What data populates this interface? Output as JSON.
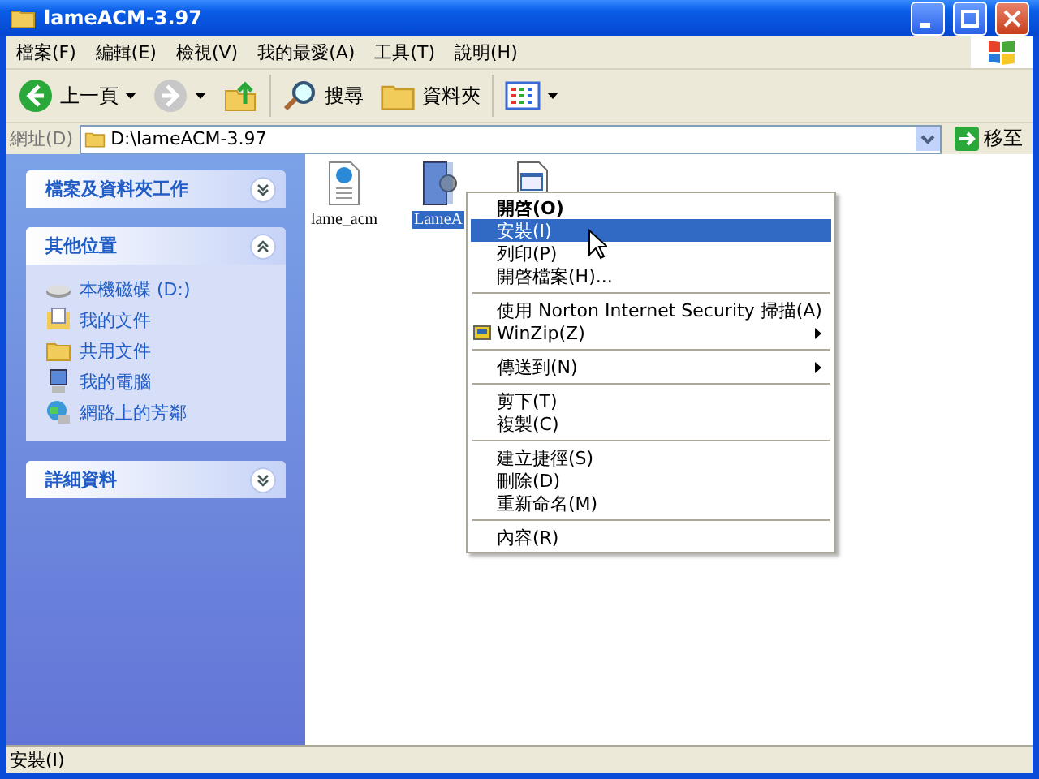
{
  "window": {
    "title": "lameACM-3.97"
  },
  "menu_bar": [
    "檔案(F)",
    "編輯(E)",
    "檢視(V)",
    "我的最愛(A)",
    "工具(T)",
    "說明(H)"
  ],
  "toolbar": [
    {
      "kind": "back",
      "label": "上一頁",
      "disabled": false
    },
    {
      "kind": "forward",
      "disabled": true
    },
    {
      "kind": "up"
    },
    {
      "kind": "search",
      "label": "搜尋",
      "disabled": false
    },
    {
      "kind": "folders",
      "label": "資料夾",
      "disabled": false
    },
    {
      "kind": "views"
    }
  ],
  "address_bar": {
    "label": "網址(D)",
    "value": "D:\\lameACM-3.97",
    "go_label": "移至"
  },
  "sidebar": {
    "panels": [
      {
        "title": "檔案及資料夾工作",
        "expanded": false
      },
      {
        "title": "其他位置",
        "expanded": true,
        "items": [
          {
            "kind": "drive",
            "label": "本機磁碟 (D:)"
          },
          {
            "kind": "documents",
            "label": "我的文件"
          },
          {
            "kind": "folder",
            "label": "共用文件"
          },
          {
            "kind": "computer",
            "label": "我的電腦"
          },
          {
            "kind": "network",
            "label": "網路上的芳鄰"
          }
        ]
      },
      {
        "title": "詳細資料",
        "expanded": false
      }
    ]
  },
  "files": [
    {
      "kind": "web",
      "name": "lame_acm",
      "selected": false
    },
    {
      "kind": "setup",
      "name": "LameA",
      "selected": true
    },
    {
      "kind": "app",
      "selected": false
    }
  ],
  "context_menu": [
    {
      "kind": "item",
      "label": "開啓(O)",
      "default": true,
      "selected": false
    },
    {
      "kind": "item",
      "label": "安裝(I)",
      "default": false,
      "selected": true
    },
    {
      "kind": "item",
      "label": "列印(P)",
      "default": false,
      "selected": false
    },
    {
      "kind": "item",
      "label": "開啓檔案(H)...",
      "default": false,
      "selected": false
    },
    {
      "kind": "separator"
    },
    {
      "kind": "item",
      "label": "使用 Norton Internet Security 掃描(A)",
      "default": false,
      "selected": false
    },
    {
      "kind": "item",
      "label": "WinZip(Z)",
      "default": false,
      "selected": false,
      "icon": true,
      "submenu": true
    },
    {
      "kind": "separator"
    },
    {
      "kind": "item",
      "label": "傳送到(N)",
      "default": false,
      "selected": false,
      "submenu": true
    },
    {
      "kind": "separator"
    },
    {
      "kind": "item",
      "label": "剪下(T)",
      "default": false,
      "selected": false
    },
    {
      "kind": "item",
      "label": "複製(C)",
      "default": false,
      "selected": false
    },
    {
      "kind": "separator"
    },
    {
      "kind": "item",
      "label": "建立捷徑(S)",
      "default": false,
      "selected": false
    },
    {
      "kind": "item",
      "label": "刪除(D)",
      "default": false,
      "selected": false
    },
    {
      "kind": "item",
      "label": "重新命名(M)",
      "default": false,
      "selected": false
    },
    {
      "kind": "separator"
    },
    {
      "kind": "item",
      "label": "內容(R)",
      "default": false,
      "selected": false
    }
  ],
  "status_bar": {
    "text": "安裝(I)"
  }
}
